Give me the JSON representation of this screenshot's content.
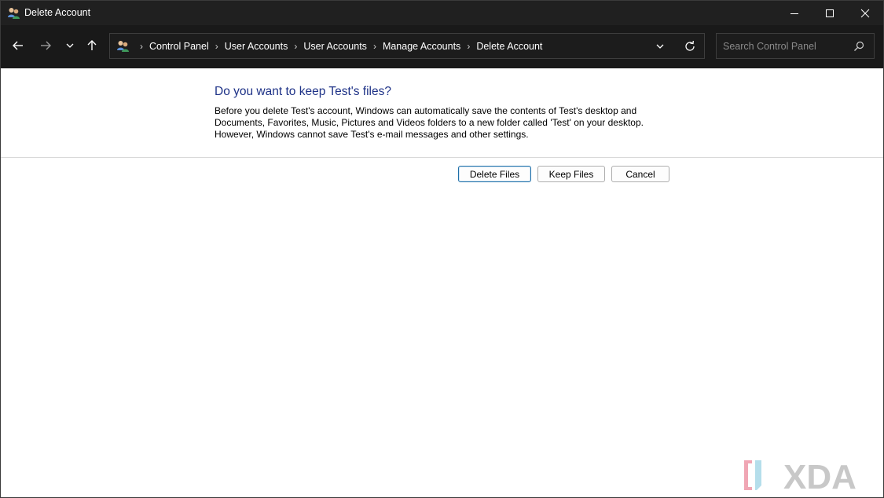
{
  "window": {
    "title": "Delete Account"
  },
  "address_bar": {
    "crumbs": [
      "Control Panel",
      "User Accounts",
      "User Accounts",
      "Manage Accounts",
      "Delete Account"
    ]
  },
  "search": {
    "placeholder": "Search Control Panel"
  },
  "content": {
    "heading": "Do you want to keep Test's files?",
    "description_lines": [
      "Before you delete Test's account, Windows can automatically save the contents of Test's desktop and",
      "Documents, Favorites, Music, Pictures and Videos folders to a new folder called 'Test' on your desktop.",
      "However, Windows cannot save Test's e-mail messages and other settings."
    ]
  },
  "buttons": {
    "delete_files": "Delete Files",
    "keep_files": "Keep Files",
    "cancel": "Cancel"
  },
  "watermark": {
    "text": "XDA"
  },
  "colors": {
    "titlebar_bg": "#202020",
    "navbar_bg": "#191919",
    "heading": "#1e3287",
    "default_button_border": "#1f6fa8",
    "watermark_accent": "#f0a6b4",
    "watermark_text": "#c8c8c8"
  },
  "icons": {
    "app": "user-accounts-icon",
    "minimize": "minimize-icon",
    "maximize": "maximize-icon",
    "close": "close-icon",
    "back": "arrow-left-icon",
    "forward": "arrow-right-icon",
    "recent": "chevron-down-icon",
    "up": "arrow-up-icon",
    "address_dropdown": "chevron-down-icon",
    "refresh": "refresh-icon",
    "search": "search-icon"
  }
}
